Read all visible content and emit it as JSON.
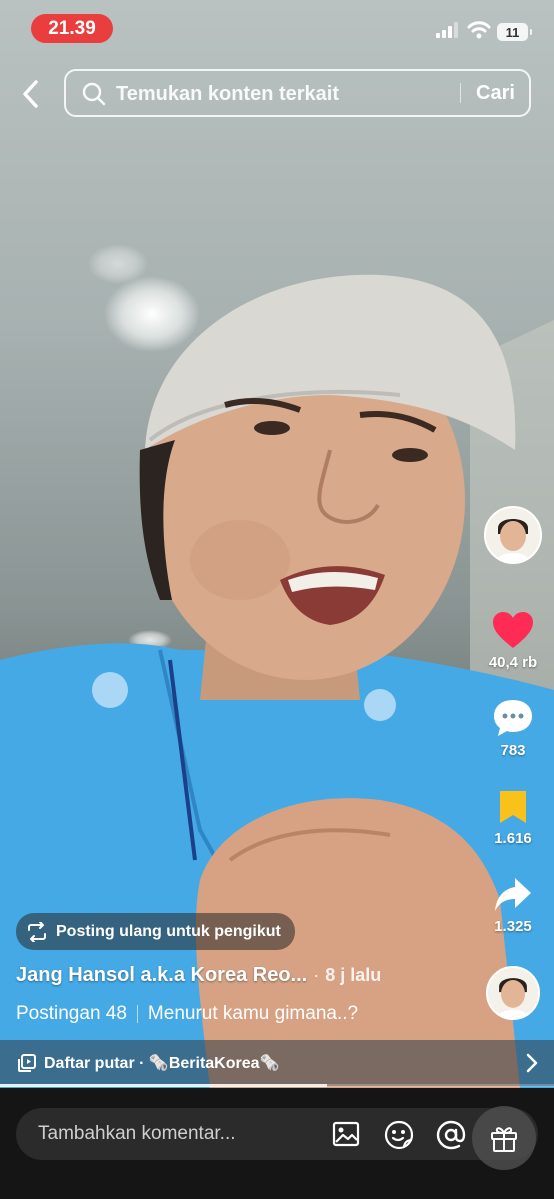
{
  "status_bar": {
    "time": "21.39",
    "battery": "11"
  },
  "search": {
    "placeholder": "Temukan konten terkait",
    "button": "Cari"
  },
  "actions": {
    "likes": "40,4 rb",
    "comments": "783",
    "saves": "1.616",
    "shares": "1.325"
  },
  "post": {
    "repost_label": "Posting ulang untuk pengikut",
    "author": "Jang Hansol a.k.a Korea Reo...",
    "separator": "·",
    "time": "8 j lalu",
    "caption_tag": "Postingan 48",
    "caption_text": "Menurut kamu gimana..?",
    "playlist": "Daftar putar · 🗞️BeritaKorea🗞️",
    "progress": 0.59
  },
  "comment": {
    "placeholder": "Tambahkan komentar..."
  },
  "colors": {
    "like": "#fe2c55",
    "save": "#f9c21b",
    "time_pill": "#ea3d3d"
  },
  "icons": [
    "back-icon",
    "search-icon",
    "heart-icon",
    "comment-icon",
    "bookmark-icon",
    "share-icon",
    "repost-icon",
    "playlist-icon",
    "chevron-right-icon",
    "image-icon",
    "emoji-icon",
    "mention-icon",
    "gift-icon"
  ]
}
